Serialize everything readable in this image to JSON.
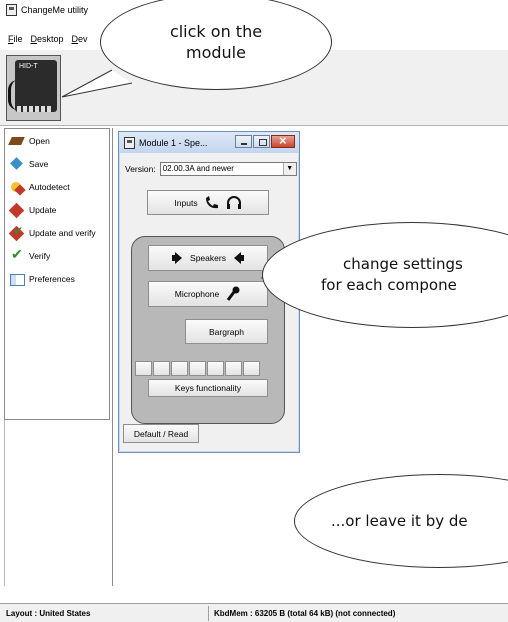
{
  "window": {
    "title": "ChangeMe utility"
  },
  "menu": [
    "File",
    "Desktop",
    "Dev"
  ],
  "device": {
    "label": "HID-T"
  },
  "sidebar": {
    "items": [
      {
        "label": "Open",
        "icon": "open-folder-icon"
      },
      {
        "label": "Save",
        "icon": "save-diamond-icon"
      },
      {
        "label": "Autodetect",
        "icon": "autodetect-icon"
      },
      {
        "label": "Update",
        "icon": "update-icon"
      },
      {
        "label": "Update and verify",
        "icon": "update-verify-icon"
      },
      {
        "label": "Verify",
        "icon": "verify-check-icon"
      },
      {
        "label": "Preferences",
        "icon": "preferences-icon"
      }
    ]
  },
  "module": {
    "title": "Module 1 - Spe...",
    "version_label": "Version:",
    "version_value": "02.00.3A and newer",
    "inputs_label": "Inputs",
    "speakers_label": "Speakers",
    "microphone_label": "Microphone",
    "bargraph_label": "Bargraph",
    "keys_label": "Keys functionality",
    "default_label": "Default / Read"
  },
  "annotations": {
    "bubble1": "click on the\nmodule",
    "bubble2_line1": "change settings",
    "bubble2_line2": "for each compone",
    "bubble3": "...or leave it by de"
  },
  "status": {
    "layout": "Layout : United States",
    "memory": "KbdMem : 63205 B   (total 64 kB) (not connected)"
  }
}
